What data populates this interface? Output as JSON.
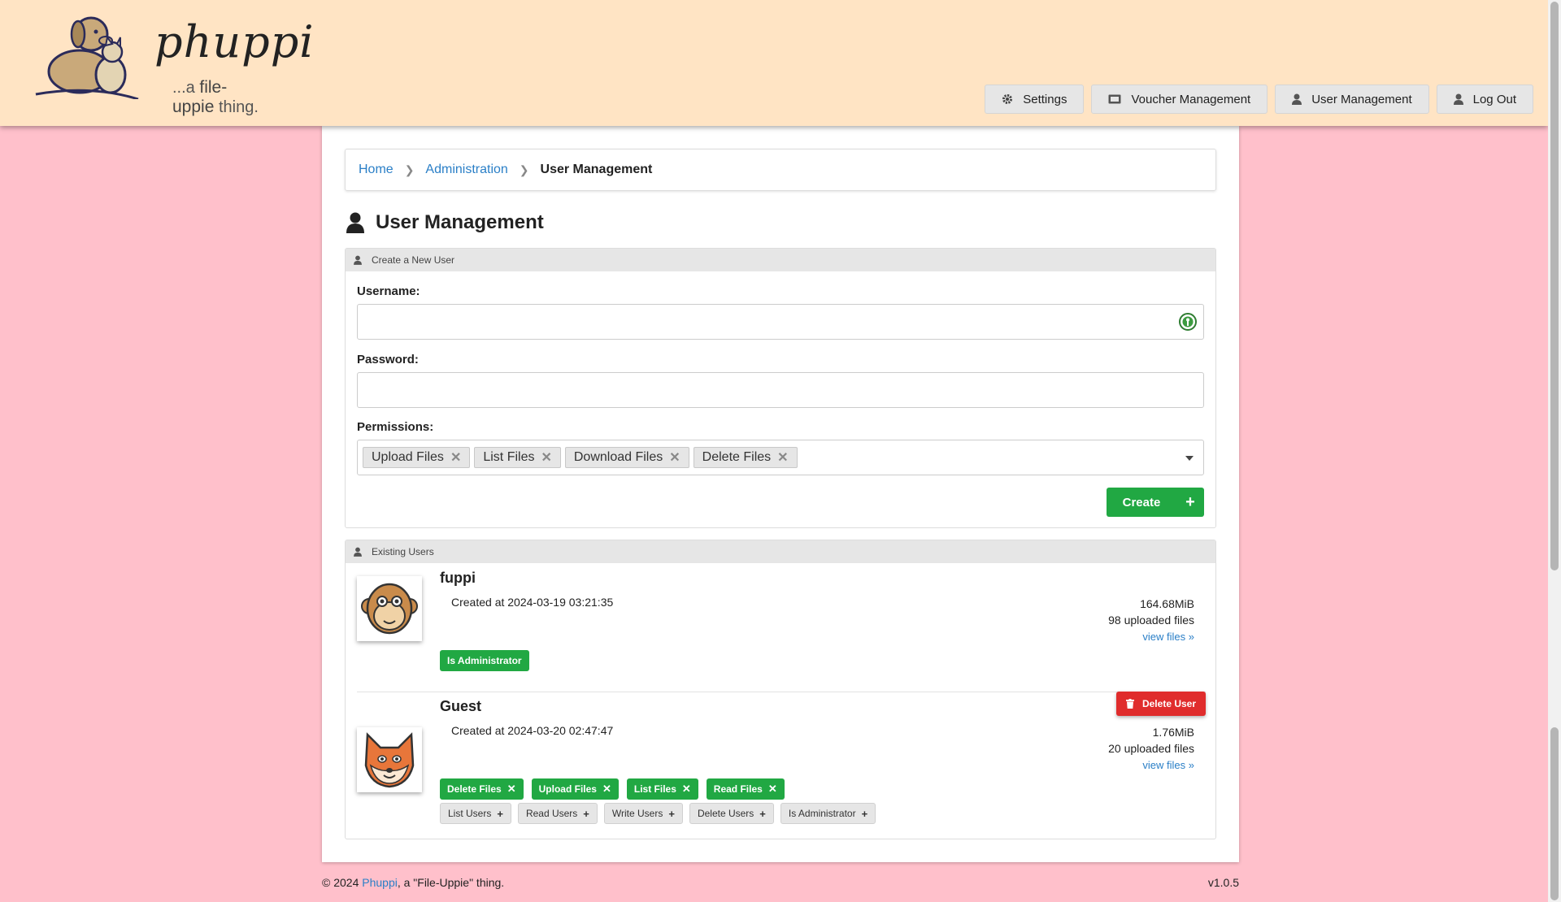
{
  "header": {
    "logo_word": "phuppi",
    "logo_tag_prefix": "...a",
    "logo_tag_main": "file-uppie",
    "logo_tag_suffix": "thing.",
    "nav": {
      "settings": "Settings",
      "vouchers": "Voucher Management",
      "users": "User Management",
      "logout": "Log Out"
    }
  },
  "breadcrumb": {
    "home": "Home",
    "admin": "Administration",
    "current": "User Management"
  },
  "page_title": "User Management",
  "create_panel": {
    "title": "Create a New User",
    "username_label": "Username:",
    "username_value": "",
    "password_label": "Password:",
    "password_value": "",
    "permissions_label": "Permissions:",
    "permissions": [
      "Upload Files",
      "List Files",
      "Download Files",
      "Delete Files"
    ],
    "create_label": "Create"
  },
  "users_panel": {
    "title": "Existing Users",
    "users": [
      {
        "name": "fuppi",
        "created": "Created at 2024-03-19 03:21:35",
        "size": "164.68MiB",
        "files": "98 uploaded files",
        "view": "view files »",
        "active_perms": [
          "Is Administrator"
        ],
        "inactive_perms": []
      },
      {
        "name": "Guest",
        "created": "Created at 2024-03-20 02:47:47",
        "size": "1.76MiB",
        "files": "20 uploaded files",
        "view": "view files »",
        "delete_label": "Delete User",
        "active_perms": [
          "Delete Files",
          "Upload Files",
          "List Files",
          "Read Files"
        ],
        "inactive_perms": [
          "List Users",
          "Read Users",
          "Write Users",
          "Delete Users",
          "Is Administrator"
        ]
      }
    ]
  },
  "footer": {
    "copyright_prefix": "© 2024 ",
    "brand": "Phuppi",
    "copyright_suffix": ", a \"File-Uppie\" thing.",
    "version": "v1.0.5"
  },
  "colors": {
    "header_bg": "#ffe4c4",
    "page_bg": "#ffc0cb",
    "green": "#21a843",
    "red": "#e02c2c",
    "link": "#2a7fc7"
  }
}
